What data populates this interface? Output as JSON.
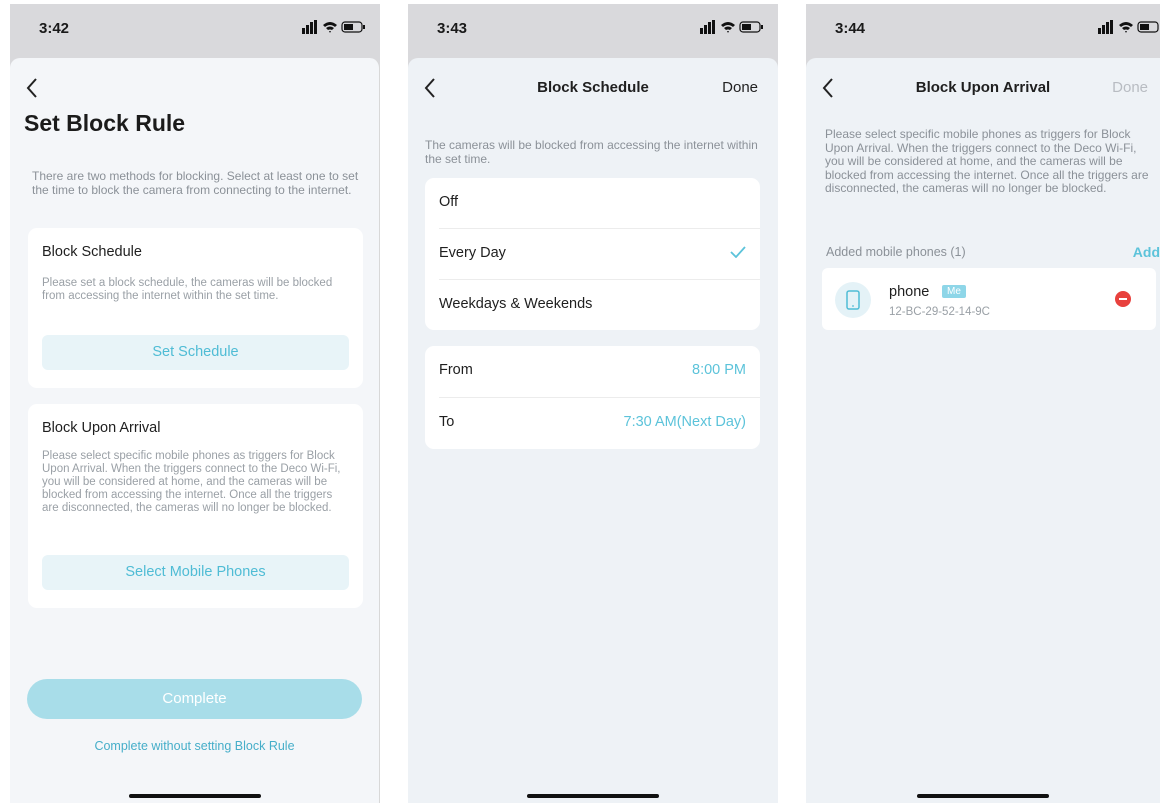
{
  "screen1": {
    "status_time": "3:42",
    "title": "Set Block Rule",
    "intro": "There are two methods for blocking. Select at least one to set the time to block the camera from connecting to the internet.",
    "schedule_card": {
      "title": "Block Schedule",
      "desc": "Please set a block schedule, the cameras will be blocked from accessing the internet within the set time.",
      "button": "Set Schedule"
    },
    "arrival_card": {
      "title": "Block Upon Arrival",
      "desc": "Please select specific mobile phones as triggers for Block Upon Arrival. When the triggers connect to the Deco Wi-Fi, you will be considered at home, and the cameras will be blocked from accessing the internet. Once all the triggers are disconnected, the cameras will no longer be blocked.",
      "button": "Select Mobile Phones"
    },
    "complete_button": "Complete",
    "skip_link": "Complete without setting Block Rule"
  },
  "screen2": {
    "status_time": "3:43",
    "title": "Block Schedule",
    "done": "Done",
    "desc": "The cameras will be blocked from accessing the internet within the set time.",
    "options": [
      "Off",
      "Every Day",
      "Weekdays & Weekends"
    ],
    "selected_option": "Every Day",
    "from_label": "From",
    "from_value": "8:00 PM",
    "to_label": "To",
    "to_value": "7:30 AM(Next Day)"
  },
  "screen3": {
    "status_time": "3:44",
    "title": "Block Upon Arrival",
    "done": "Done",
    "desc": "Please select specific mobile phones as triggers for Block Upon Arrival. When the triggers connect to the Deco Wi-Fi, you will be considered at home, and the cameras will be blocked from accessing the internet. Once all the triggers are disconnected, the cameras will no longer be blocked.",
    "section_label": "Added mobile phones (1)",
    "add": "Add",
    "device": {
      "name": "phone",
      "badge": "Me",
      "mac": "12-BC-29-52-14-9C",
      "icon": "mobile-phone-icon"
    }
  },
  "colors": {
    "accent": "#5cc3da",
    "button_disabled": "#a8dde9",
    "remove": "#e8413d"
  }
}
